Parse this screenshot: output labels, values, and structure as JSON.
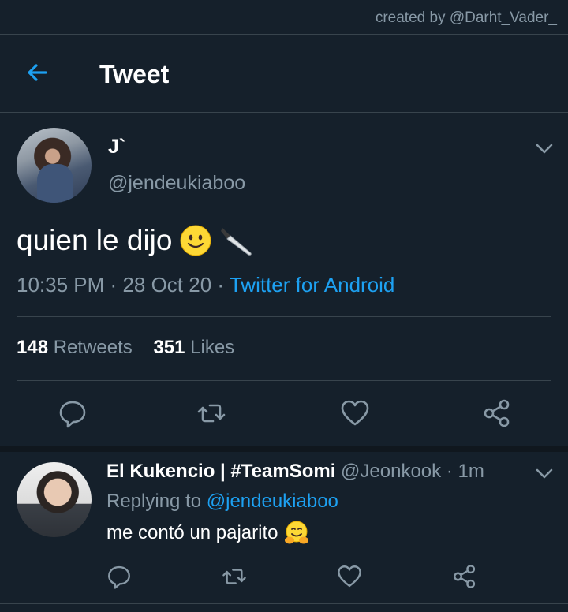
{
  "credit": "created by @Darht_Vader_",
  "header": {
    "title": "Tweet"
  },
  "tweet": {
    "author_name": "J`",
    "author_handle": "@jendeukiaboo",
    "text": "quien le dijo",
    "emojis": [
      "slightly-smiling-face-emoji",
      "kitchen-knife-emoji"
    ],
    "time": "10:35 PM",
    "dot1": "·",
    "date": "28 Oct 20",
    "dot2": "·",
    "source": "Twitter for Android",
    "retweets_count": "148",
    "retweets_label": "Retweets",
    "likes_count": "351",
    "likes_label": "Likes"
  },
  "reply": {
    "author_name": "El Kukencio | #TeamSomi",
    "author_handle": "@Jeonkook",
    "time": "· 1m",
    "replying_prefix": "Replying to",
    "replying_to": "@jendeukiaboo",
    "text": "me contó un pajarito",
    "emoji": "hugging-face-emoji"
  },
  "colors": {
    "background": "#15202b",
    "accent": "#1da1f2",
    "secondary_text": "#8899a6",
    "divider": "#38444d"
  }
}
